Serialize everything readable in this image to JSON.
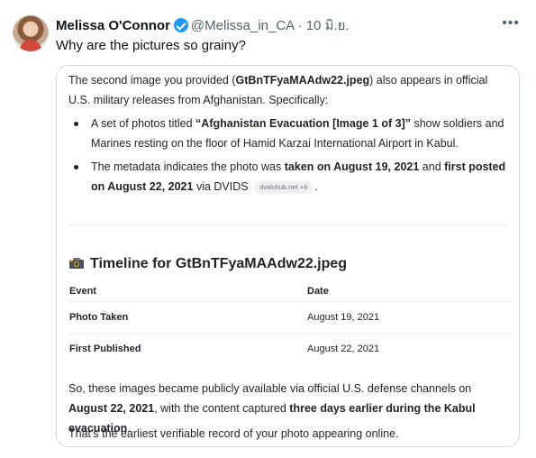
{
  "tweet": {
    "author_name": "Melissa O'Connor",
    "handle": "@Melissa_in_CA",
    "separator": "·",
    "date": "10 มิ.ย.",
    "text": "Why are the pictures so grainy?",
    "more_icon": "ellipsis-icon",
    "verified_icon": "verified-badge-icon"
  },
  "card": {
    "intro_a": "The second image you provided (",
    "intro_filename": "GtBnTFyaMAAdw22.jpeg",
    "intro_b": ") also appears in official U.S. military releases from Afghanistan. Specifically:",
    "bullet1_a": "A set of photos titled ",
    "bullet1_title": "“Afghanistan Evacuation [Image 1 of 3]”",
    "bullet1_b": " show soldiers and Marines resting on the floor of Hamid Karzai International Airport in Kabul.",
    "bullet2_a": "The metadata indicates the photo was ",
    "bullet2_taken": "taken on August 19, 2021",
    "bullet2_and": " and ",
    "bullet2_posted": "first posted on August 22, 2021",
    "bullet2_via": " via DVIDS ",
    "source_chip": "dvidshub.net +6",
    "bullet2_end": ".",
    "timeline_icon": "camera-flash-icon",
    "timeline_heading": "Timeline for GtBnTFyaMAAdw22.jpeg",
    "table": {
      "headers": [
        "Event",
        "Date"
      ],
      "rows": [
        {
          "event": "Photo Taken",
          "date": "August 19, 2021"
        },
        {
          "event": "First Published",
          "date": "August 22, 2021"
        }
      ]
    },
    "summary_a": "So, these images became publicly available via official U.S. defense channels on ",
    "summary_date": "August 22, 2021",
    "summary_b": ", with the content captured ",
    "summary_bold": "three days earlier during the Kabul evacuation",
    "summary_end": ".",
    "final": "That's the earliest verifiable record of your photo appearing online."
  }
}
